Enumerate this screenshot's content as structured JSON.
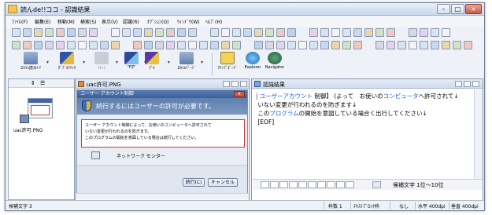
{
  "window": {
    "title": "読んde!!ココ - 認識結果"
  },
  "menubar": [
    "ﾌｧｲﾙ(F)",
    "編集(E)",
    "移動(M)",
    "検索(S)",
    "表示(V)",
    "認識(R)",
    "ｵﾌﾟｼｮﾝ(O)",
    "ｳｨﾝﾄﾞｳ(W)",
    "ﾍﾙﾌﾟ(H)"
  ],
  "big_toolbar": [
    "2ｶﾗﾑ読みﾄﾘ",
    "ﾀﾞﾌﾞﾙｸﾘｯｸ",
    "ｽｷｬﾅ",
    "\"FZ\"",
    "ｸﾞﾙ",
    "2ｶﾗﾑﾍﾟｰｼﾞ",
    "ｸﾘｯﾌﾟﾎﾞｰﾄﾞ",
    "Explorer",
    "Navigator"
  ],
  "left_pane": {
    "file_label": "uac許可.PNG"
  },
  "image_window": {
    "title": "uac許可.PNG",
    "uac_dialog": {
      "title": "ユーザー アカウント制御",
      "heading": "続行するにはユーザーの許可が必要です。",
      "body_lines": [
        "ユーザー アカウント制御によって、お使いのコンピュータへ許可されて",
        "いない変更が行われるのを防ぎます。",
        "このプログラムの開始を意図している場合は続行してください。"
      ],
      "program": "ネットワーク センター",
      "continue_label": "続行(C)",
      "cancel_label": "キャンセル"
    }
  },
  "result_window": {
    "title": "認識結果",
    "status": "候補文字 1位〜10位"
  },
  "statusbar": {
    "left": "候補文字 3",
    "mid1": "枠数 1",
    "mid2": "ﾃｷｽﾄﾌﾞﾛｯｸ枠",
    "mid3": "なし",
    "res_h": "水平 400dpi",
    "res_v": "垂直 400dpi"
  }
}
